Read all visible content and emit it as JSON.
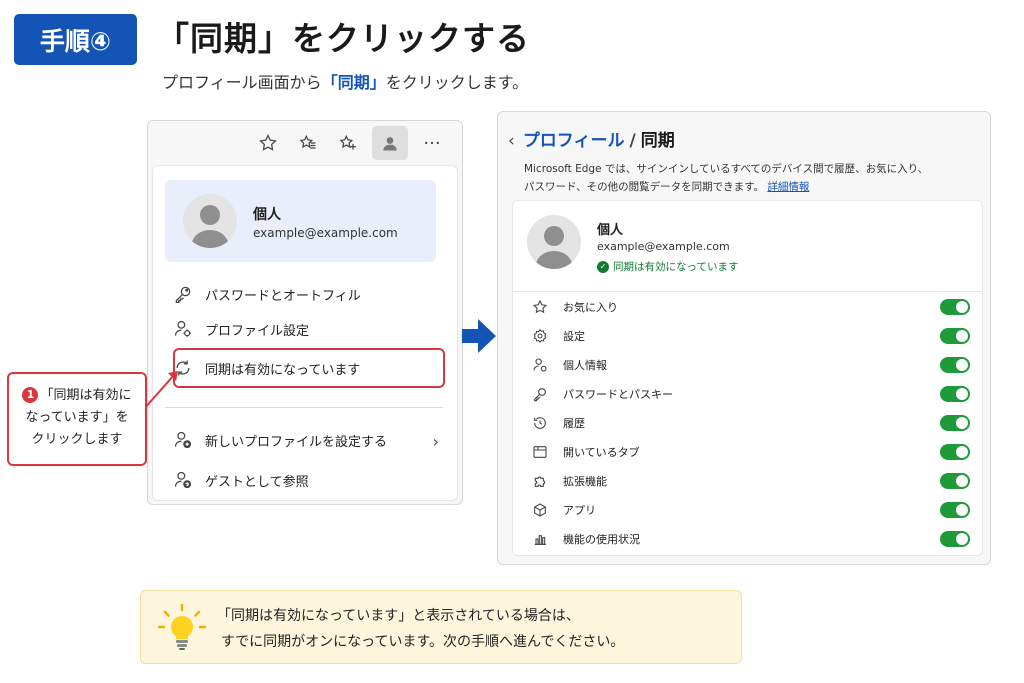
{
  "header": {
    "step_badge": "手順④",
    "title": "「同期」をクリックする",
    "subtitle_pre": "プロフィール画面から",
    "subtitle_highlight": "「同期」",
    "subtitle_post": "をクリックします。"
  },
  "browser": {
    "toolbar_icons": [
      "star-icon",
      "favorites-icon",
      "add-favorite-icon",
      "profile-icon",
      "more-icon"
    ],
    "more_label": "···",
    "profile": {
      "name": "個人",
      "email": "example@example.com"
    },
    "menu": {
      "passwords": "パスワードとオートフィル",
      "profile_settings": "プロファイル設定",
      "sync": "同期は有効になっています",
      "new_profile": "新しいプロファイルを設定する",
      "guest": "ゲストとして参照",
      "chevron": "›"
    }
  },
  "callout": {
    "number": "1",
    "line1": "「同期は有効に",
    "line2": "なっています」を",
    "line3": "クリックします"
  },
  "settings": {
    "back": "‹",
    "crumb_link": "プロフィール",
    "crumb_sep": "/",
    "crumb_current": "同期",
    "desc_line1": "Microsoft Edge では、サインインしているすべてのデバイス間で履歴、お気に入り、",
    "desc_line2": "パスワード、その他の閲覧データを同期できます。",
    "desc_link": "詳細情報",
    "account": {
      "name": "個人",
      "email": "example@example.com",
      "status": "同期は有効になっています"
    },
    "items": [
      {
        "label": "お気に入り",
        "icon": "star-icon",
        "on": true
      },
      {
        "label": "設定",
        "icon": "gear-icon",
        "on": true
      },
      {
        "label": "個人情報",
        "icon": "person-info-icon",
        "on": true
      },
      {
        "label": "パスワードとパスキー",
        "icon": "key-icon",
        "on": true
      },
      {
        "label": "履歴",
        "icon": "history-icon",
        "on": true
      },
      {
        "label": "開いているタブ",
        "icon": "tabs-icon",
        "on": true
      },
      {
        "label": "拡張機能",
        "icon": "puzzle-icon",
        "on": true
      },
      {
        "label": "アプリ",
        "icon": "cube-icon",
        "on": true
      },
      {
        "label": "機能の使用状況",
        "icon": "bar-chart-icon",
        "on": true
      }
    ]
  },
  "tip": {
    "line1": "「同期は有効になっています」と表示されている場合は、",
    "line2": "すでに同期がオンになっています。次の手順へ進んでください。"
  },
  "colors": {
    "accent_blue": "#1554b7",
    "callout_red": "#d9363e",
    "toggle_green": "#1e9a3a",
    "tip_bg": "#fdf6dc"
  }
}
